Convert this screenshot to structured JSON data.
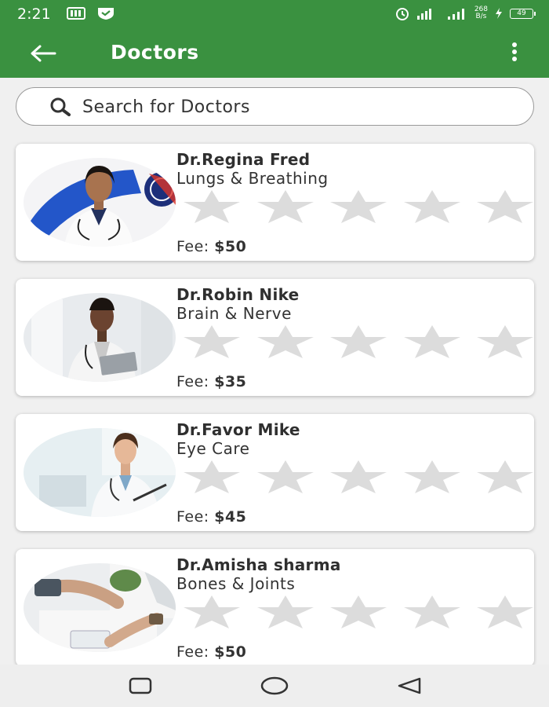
{
  "status_bar": {
    "time": "2:21",
    "net_speed_value": "268",
    "net_speed_unit": "B/s",
    "battery": "49"
  },
  "header": {
    "title": "Doctors"
  },
  "search": {
    "placeholder": "Search for Doctors"
  },
  "doctors": [
    {
      "name": "Dr.Regina Fred",
      "specialty": "Lungs & Breathing",
      "fee_label": "Fee:",
      "fee": "$50",
      "rating": 0,
      "max_rating": 5
    },
    {
      "name": "Dr.Robin Nike",
      "specialty": "Brain & Nerve",
      "fee_label": "Fee:",
      "fee": "$35",
      "rating": 0,
      "max_rating": 5
    },
    {
      "name": "Dr.Favor Mike",
      "specialty": "Eye Care",
      "fee_label": "Fee:",
      "fee": "$45",
      "rating": 0,
      "max_rating": 5
    },
    {
      "name": "Dr.Amisha sharma",
      "specialty": "Bones & Joints",
      "fee_label": "Fee:",
      "fee": "$50",
      "rating": 0,
      "max_rating": 5
    }
  ],
  "colors": {
    "app_bar": "#3a9140",
    "star_empty": "#dcdcdc",
    "background": "#f0f0f0"
  },
  "icons": {
    "back": "arrow-left-icon",
    "menu": "more-vert-icon",
    "search": "search-icon",
    "nav_recents": "square-icon",
    "nav_home": "circle-icon",
    "nav_back": "triangle-icon"
  }
}
